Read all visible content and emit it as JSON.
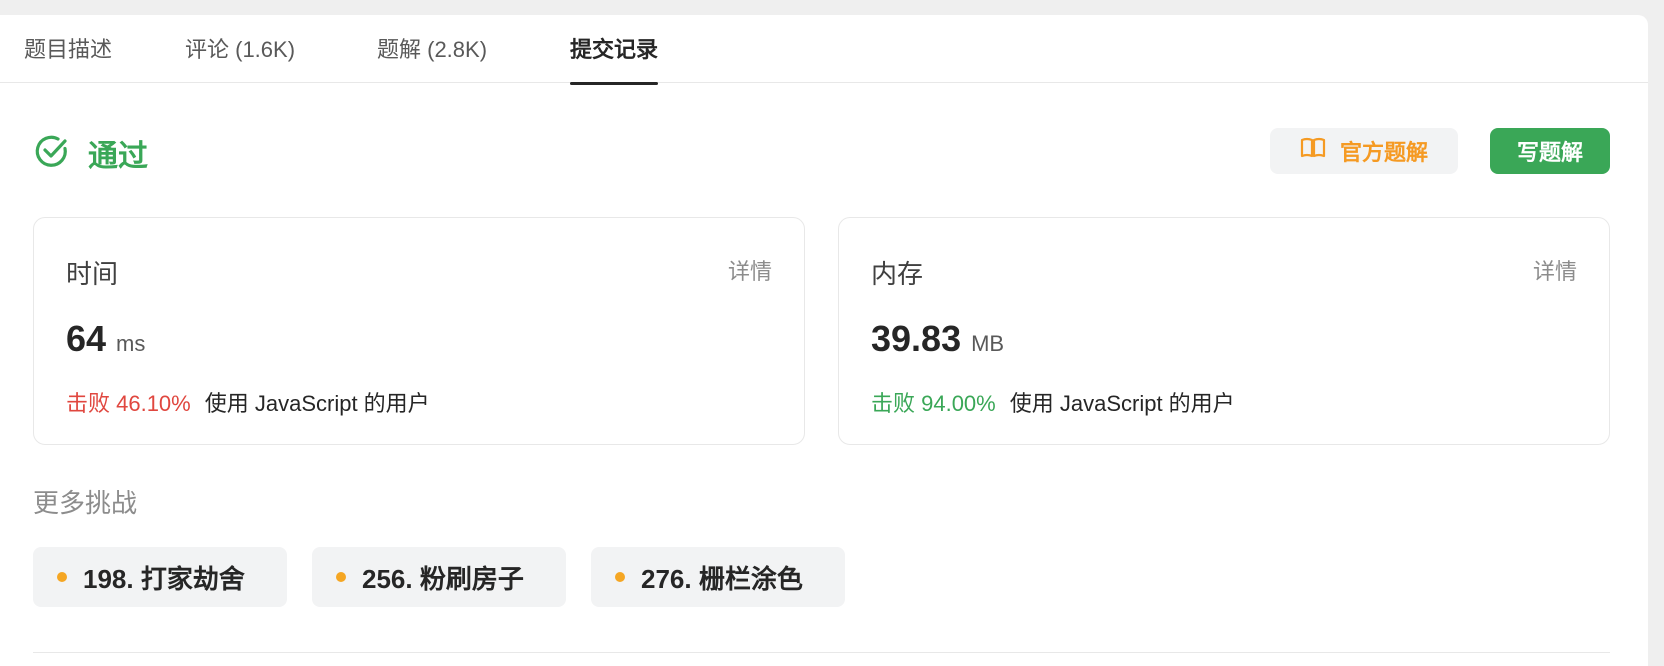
{
  "tabs": [
    {
      "label": "题目描述"
    },
    {
      "label": "评论 (1.6K)"
    },
    {
      "label": "题解 (2.8K)"
    },
    {
      "label": "提交记录"
    }
  ],
  "active_tab": "提交记录",
  "status": {
    "text": "通过",
    "color": "#3aa757",
    "icon": "check-circle-icon"
  },
  "actions": {
    "official_solution": "官方题解",
    "official_icon": "book-icon",
    "write_solution": "写题解"
  },
  "time_card": {
    "title": "时间",
    "detail": "详情",
    "value": "64",
    "unit": "ms",
    "beat": "击败 46.10%",
    "beat_suffix": "使用 JavaScript 的用户",
    "beat_color": "#e0473f"
  },
  "memory_card": {
    "title": "内存",
    "detail": "详情",
    "value": "39.83",
    "unit": "MB",
    "beat": "击败 94.00%",
    "beat_suffix": "使用 JavaScript 的用户",
    "beat_color": "#3aa757"
  },
  "more": {
    "title": "更多挑战",
    "items": [
      {
        "label": "198. 打家劫舍"
      },
      {
        "label": "256. 粉刷房子"
      },
      {
        "label": "276. 栅栏涂色"
      }
    ]
  }
}
